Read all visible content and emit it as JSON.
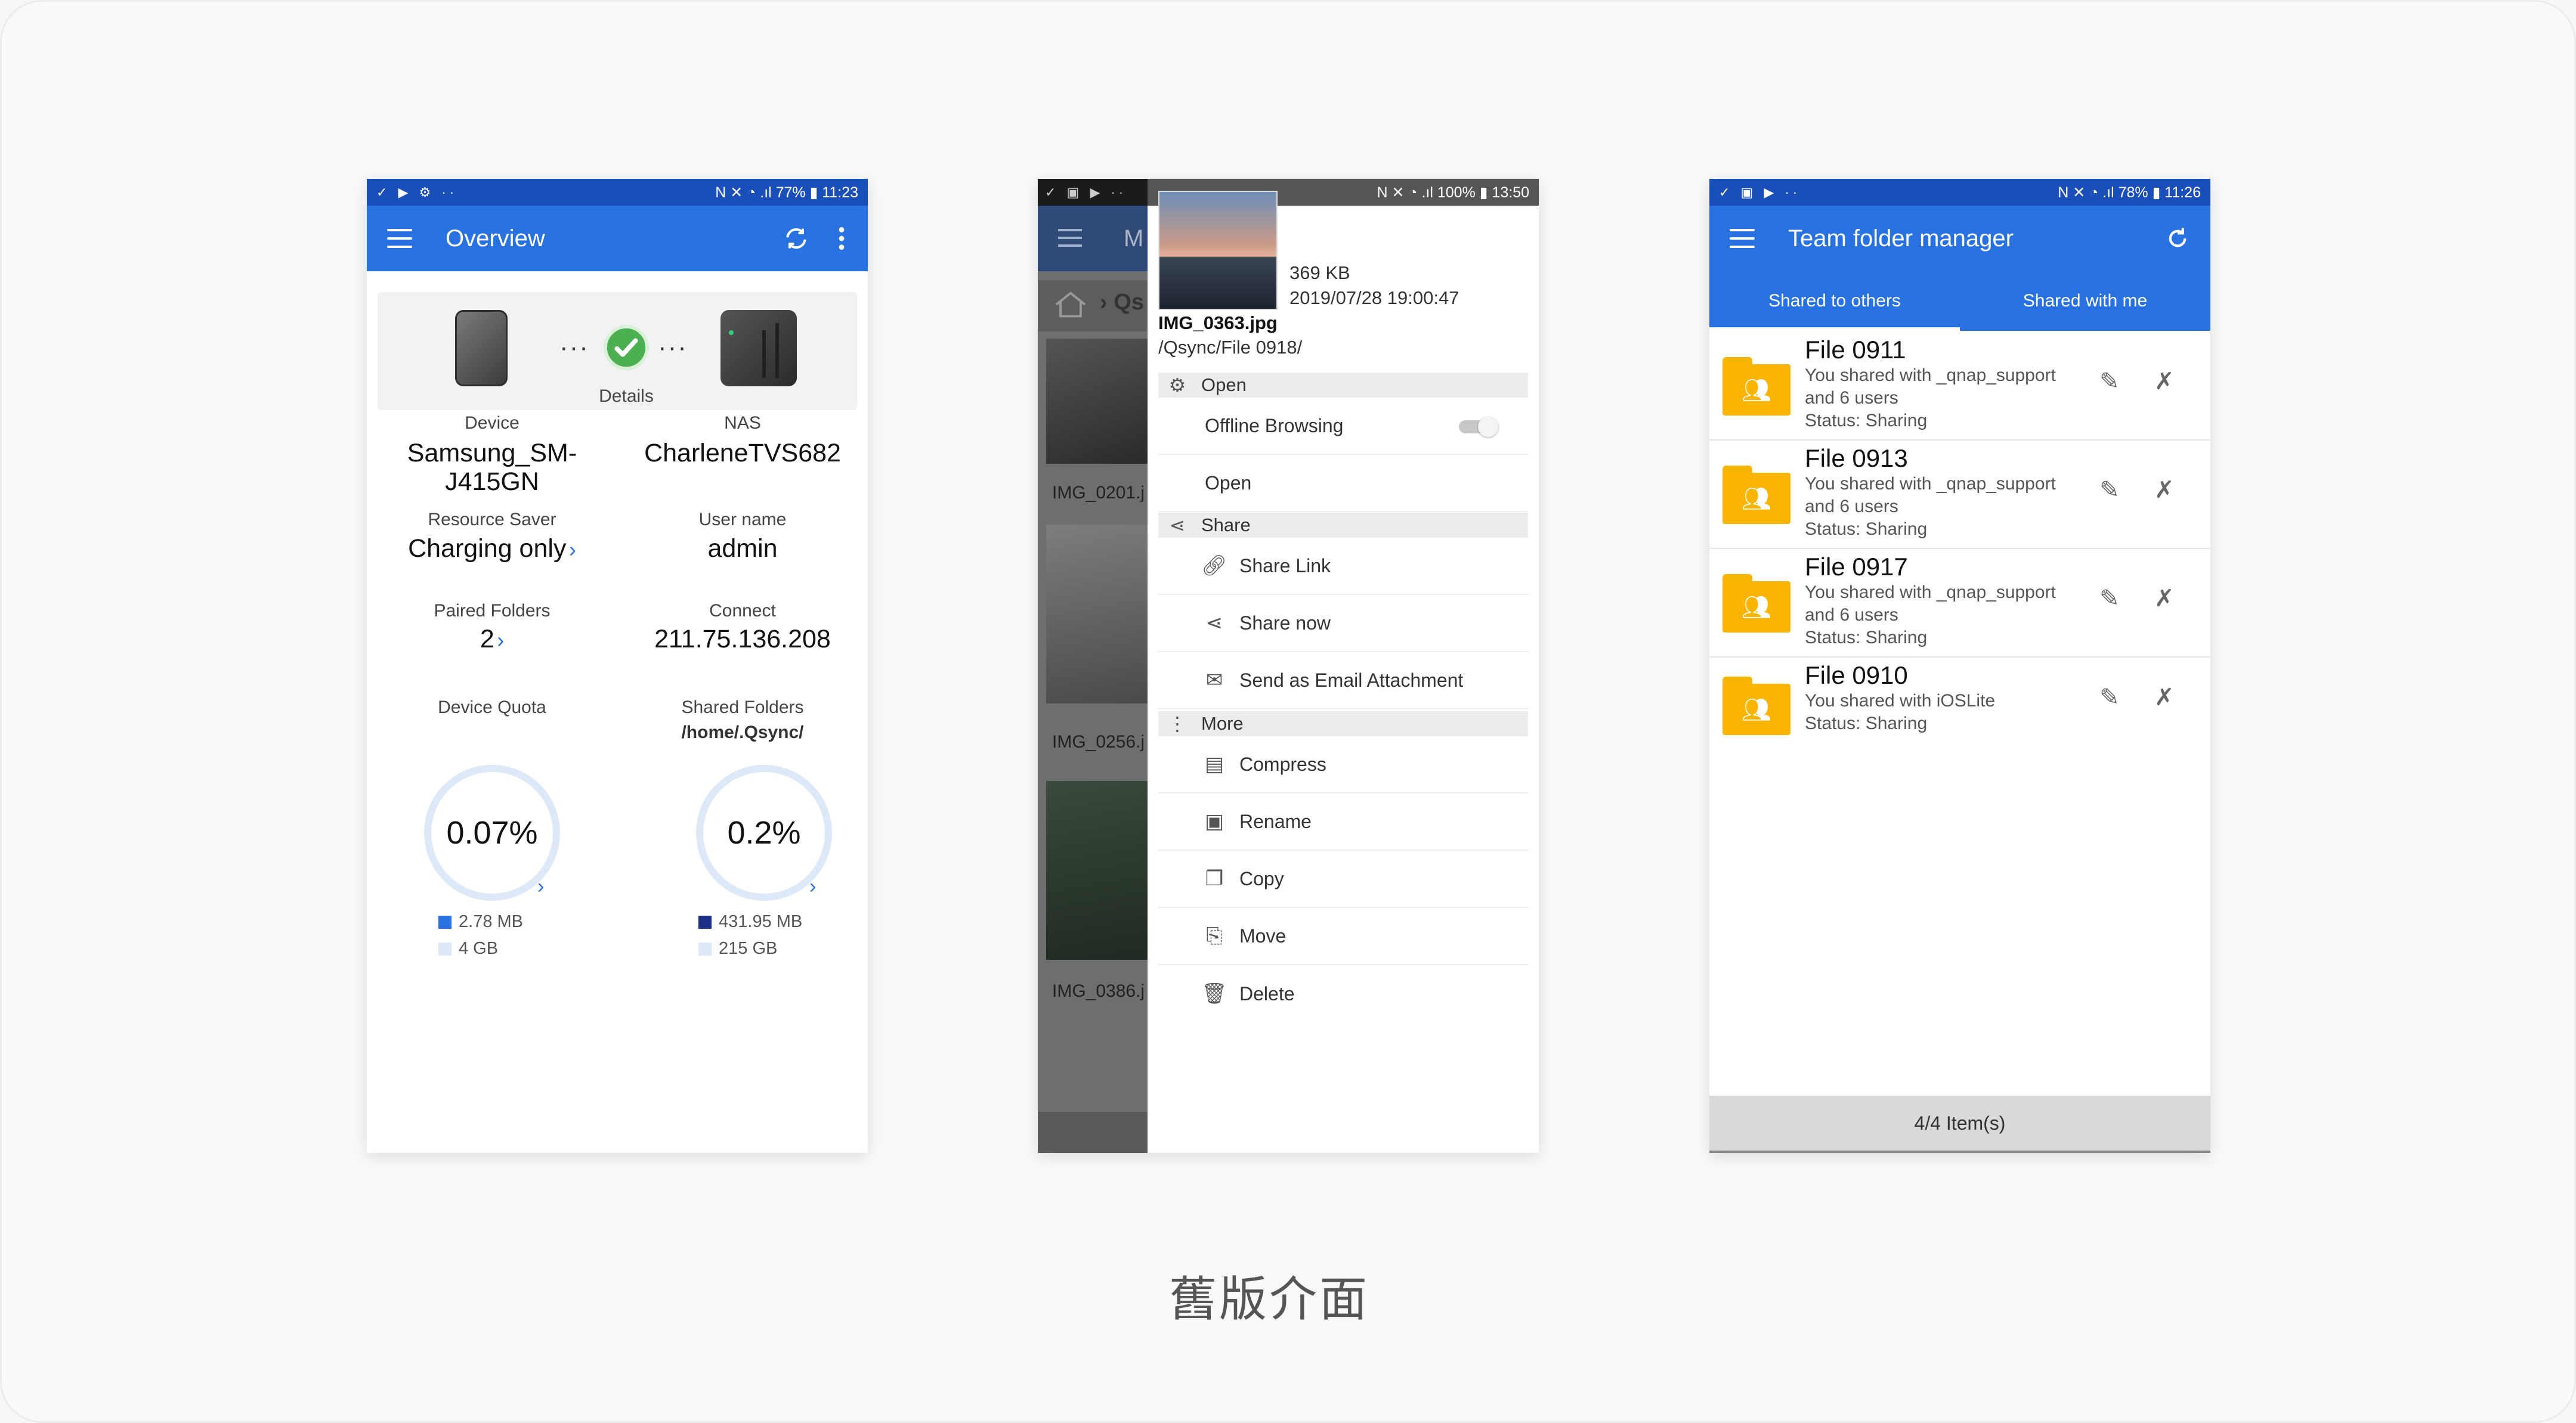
{
  "overview": {
    "status_left": "✓ ▶ ⚙ ··",
    "status_right": "N ✕ ◔ .ıl 77% ▮ 11:23",
    "title": "Overview",
    "details_label": "Details",
    "device_label": "Device",
    "device_name": "Samsung_SM-J415GN",
    "nas_label": "NAS",
    "nas_name": "CharleneTVS682",
    "resource_saver_label": "Resource Saver",
    "resource_saver_value": "Charging only",
    "user_name_label": "User name",
    "user_name_value": "admin",
    "paired_folders_label": "Paired Folders",
    "paired_folders_value": "2",
    "connect_label": "Connect",
    "connect_value": "211.75.136.208",
    "device_quota_label": "Device Quota",
    "shared_folders_label": "Shared Folders",
    "shared_folders_path": "/home/.Qsync/",
    "device_quota_percent": "0.07%",
    "shared_quota_percent": "0.2%",
    "device_used": "2.78 MB",
    "device_total": "4 GB",
    "shared_used": "431.95 MB",
    "shared_total": "215 GB",
    "colors": {
      "used_device": "#2771e0",
      "used_shared": "#1a2f86",
      "total": "#dde8f8"
    }
  },
  "file_menu": {
    "status_left": "✓ ▣ ▶ ··",
    "status_right": "N ✕ ◔ .ıl 100% ▮ 13:50",
    "size": "369 KB",
    "date": "2019/07/28 19:00:47",
    "filename": "IMG_0363.jpg",
    "path": "/Qsync/File 0918/",
    "bg_title_fragment": "M",
    "bg_path_fragment": "Qs",
    "bg_files": [
      "IMG_0201.j",
      "IMG_0256.j",
      "IMG_0386.j"
    ],
    "sections": {
      "open": "Open",
      "share": "Share",
      "more": "More"
    },
    "items": {
      "offline_browsing": "Offline Browsing",
      "open": "Open",
      "share_link": "Share Link",
      "share_now": "Share now",
      "send_email": "Send as Email Attachment",
      "compress": "Compress",
      "rename": "Rename",
      "copy": "Copy",
      "move": "Move",
      "delete": "Delete"
    }
  },
  "team_folder": {
    "status_left": "✓ ▣ ▶ ··",
    "status_right": "N ✕ ◔ .ıl 78% ▮ 11:26",
    "title": "Team folder manager",
    "tabs": [
      "Shared to others",
      "Shared with me"
    ],
    "rows": [
      {
        "name": "File 0911",
        "line1": "You shared with _qnap_support",
        "line2": "and 6 users",
        "status": "Status: Sharing"
      },
      {
        "name": "File 0913",
        "line1": "You shared with _qnap_support",
        "line2": "and 6 users",
        "status": "Status: Sharing"
      },
      {
        "name": "File 0917",
        "line1": "You shared with _qnap_support",
        "line2": "and 6 users",
        "status": "Status: Sharing"
      },
      {
        "name": "File 0910",
        "line1": "You shared with iOSLite",
        "line2": "Status: Sharing",
        "status": ""
      }
    ],
    "footer": "4/4 Item(s)"
  },
  "caption": "舊版介面"
}
